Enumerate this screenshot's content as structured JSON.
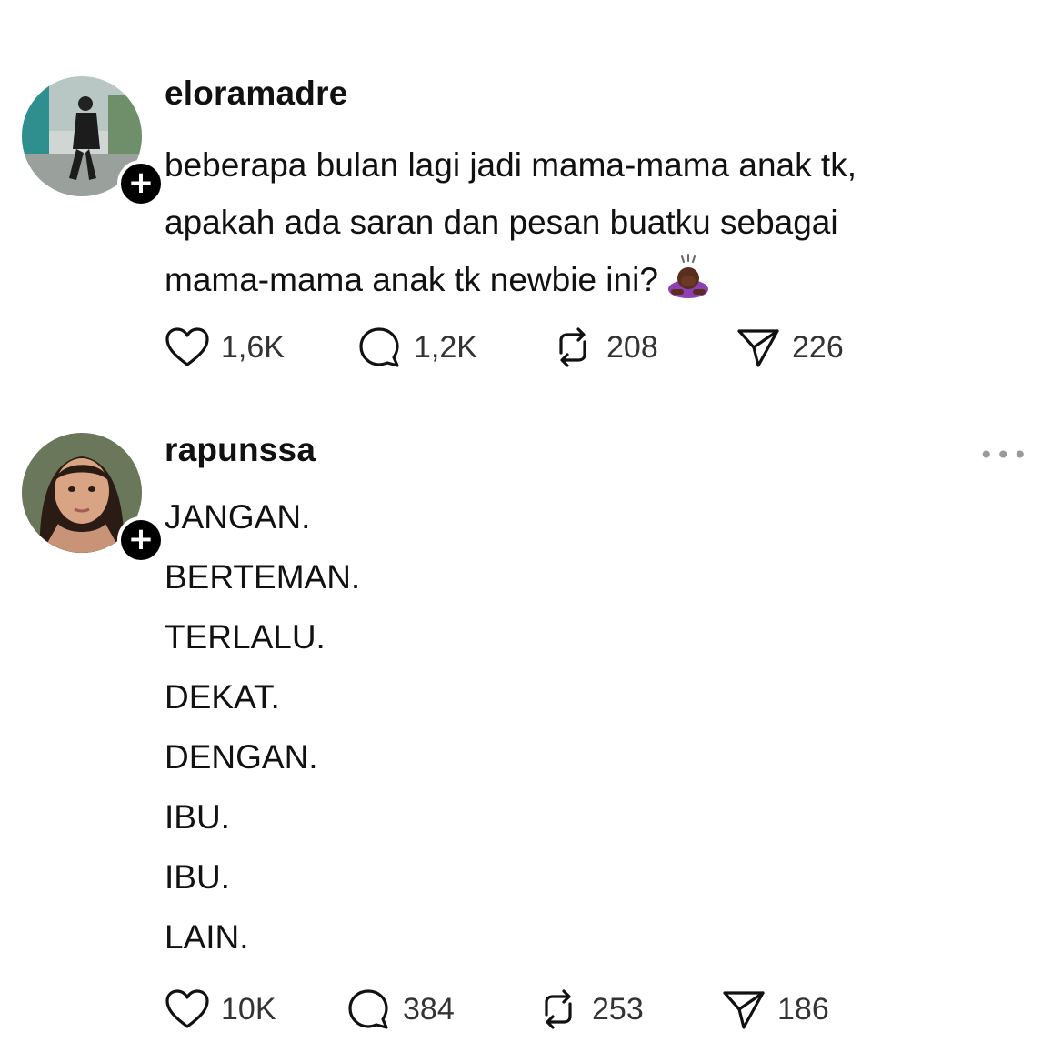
{
  "posts": [
    {
      "username": "eloramadre",
      "text_lines": [
        "beberapa bulan lagi jadi mama-mama anak tk,",
        "apakah ada saran dan pesan buatku sebagai",
        "mama-mama anak tk newbie ini?"
      ],
      "emoji": "person-bowing-emoji",
      "likes": "1,6K",
      "replies": "1,2K",
      "reposts": "208",
      "shares": "226"
    },
    {
      "username": "rapunssa",
      "more_label": "•••",
      "text_lines": [
        "JANGAN.",
        "BERTEMAN.",
        "TERLALU.",
        "DEKAT.",
        "DENGAN.",
        "IBU.",
        "IBU.",
        "LAIN."
      ],
      "likes": "10K",
      "replies": "384",
      "reposts": "253",
      "shares": "186"
    }
  ],
  "follow_badge_label": "+",
  "icons": {
    "like": "heart-icon",
    "reply": "speech-bubble-icon",
    "repost": "repost-arrows-icon",
    "share": "paper-plane-icon"
  }
}
